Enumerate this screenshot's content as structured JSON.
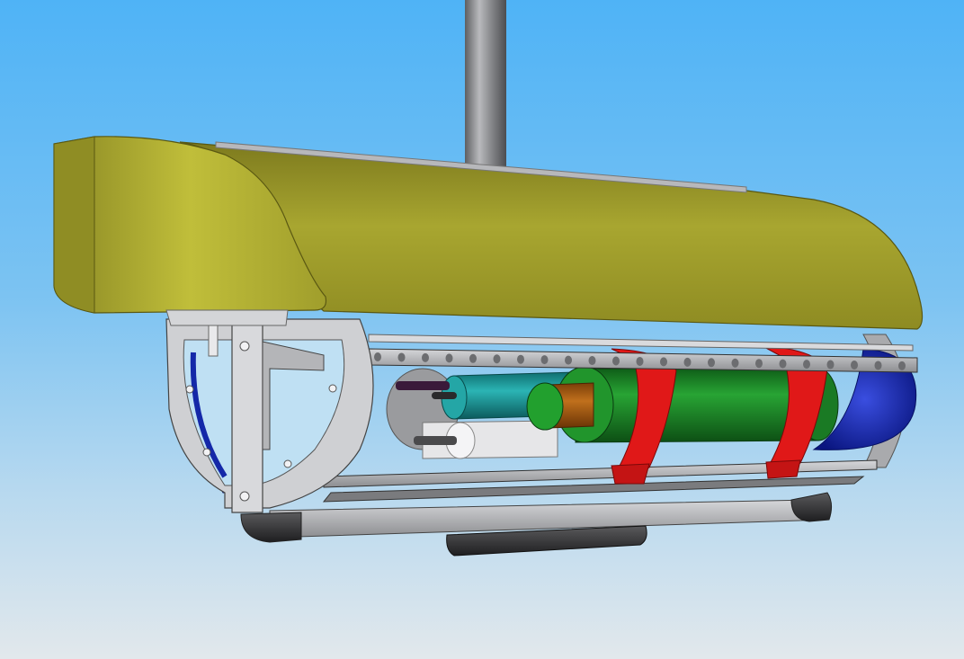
{
  "scene": {
    "background": {
      "top_color": "#4fb3f6",
      "bottom_color": "#e2e8ec"
    },
    "colors": {
      "float_foam": "#9c9a2a",
      "frame_steel": "#c9cacd",
      "mast": "#8b8c8f",
      "end_cap": "#1428a8",
      "clamp_ring": "#e01818",
      "battery_tube": "#1f8a2a",
      "motor_teal": "#1b9a9a",
      "core_brown": "#a85a10",
      "skid": "#3a3a3c"
    }
  }
}
